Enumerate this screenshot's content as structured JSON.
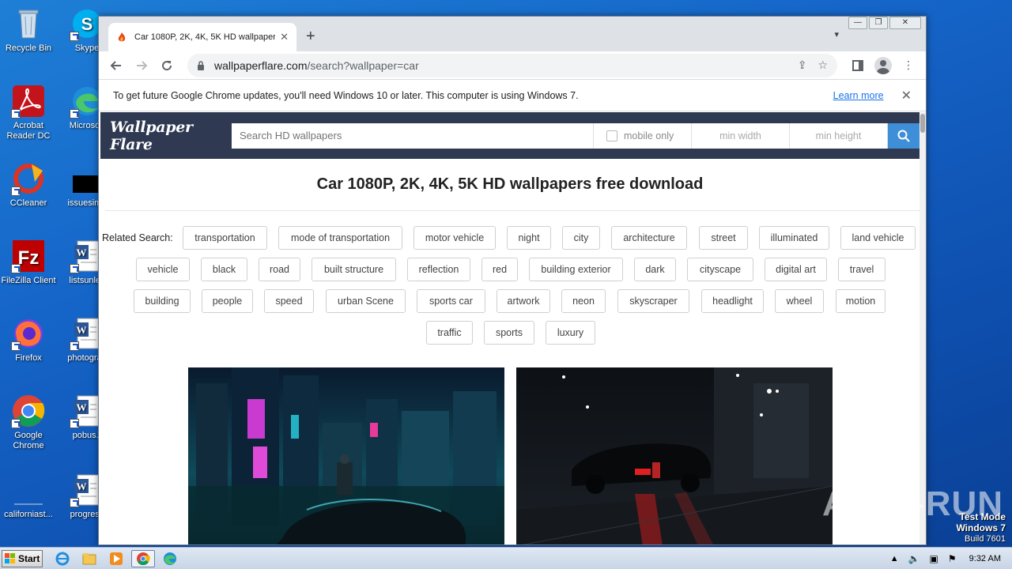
{
  "desktop": {
    "icons": [
      {
        "label": "Recycle Bin"
      },
      {
        "label": "Skype"
      },
      {
        "label": "Acrobat Reader DC"
      },
      {
        "label": "Microsoft"
      },
      {
        "label": "CCleaner"
      },
      {
        "label": "issuesimp"
      },
      {
        "label": "FileZilla Client"
      },
      {
        "label": "listsunles"
      },
      {
        "label": "Firefox"
      },
      {
        "label": "photograp"
      },
      {
        "label": "Google Chrome"
      },
      {
        "label": "pobus.r"
      },
      {
        "label": "californiast..."
      },
      {
        "label": "progress"
      }
    ]
  },
  "browser": {
    "tab_title": "Car 1080P, 2K, 4K, 5K HD wallpaper",
    "new_tab": "+",
    "url_host": "wallpaperflare.com",
    "url_path": "/search?wallpaper=car",
    "infobar_message": "To get future Google Chrome updates, you'll need Windows 10 or later. This computer is using Windows 7.",
    "infobar_link": "Learn more"
  },
  "site": {
    "logo": "Wallpaper Flare",
    "search_placeholder": "Search HD wallpapers",
    "mobile_only": "mobile only",
    "min_width": "min width",
    "min_height": "min height",
    "heading": "Car 1080P, 2K, 4K, 5K HD wallpapers free download",
    "related_label": "Related Search:",
    "tags": [
      "transportation",
      "mode of transportation",
      "motor vehicle",
      "night",
      "city",
      "architecture",
      "street",
      "illuminated",
      "land vehicle",
      "vehicle",
      "black",
      "road",
      "built structure",
      "reflection",
      "red",
      "building exterior",
      "dark",
      "cityscape",
      "digital art",
      "travel",
      "building",
      "people",
      "speed",
      "urban Scene",
      "sports car",
      "artwork",
      "neon",
      "skyscraper",
      "headlight",
      "wheel",
      "motion",
      "traffic",
      "sports",
      "luxury"
    ]
  },
  "taskbar": {
    "start": "Start",
    "clock": "9:32 AM"
  },
  "watermark": {
    "line1": "Test Mode",
    "line2": "Windows 7",
    "line3": "Build 7601",
    "brand": "ANY▷RUN"
  }
}
